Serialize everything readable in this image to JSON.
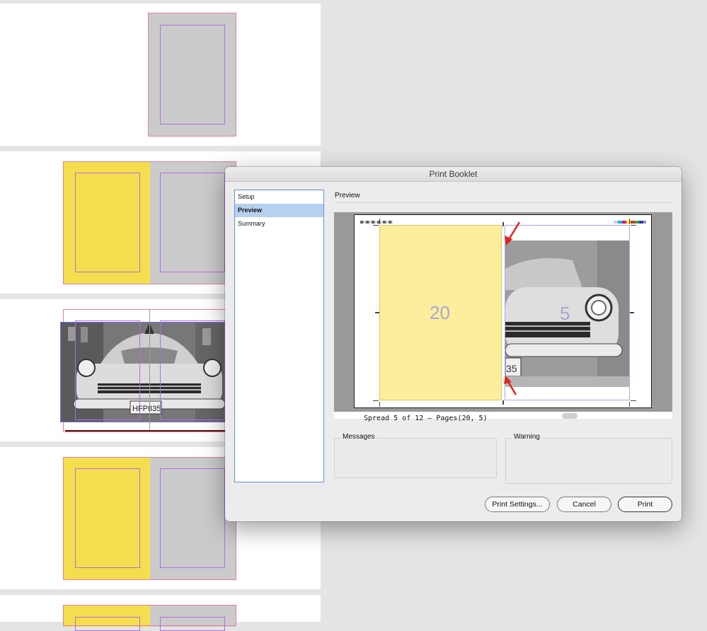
{
  "dialog": {
    "title": "Print Booklet",
    "sidebar": [
      {
        "label": "Setup",
        "active": false
      },
      {
        "label": "Preview",
        "active": true
      },
      {
        "label": "Summary",
        "active": false
      }
    ],
    "section_heading": "Preview",
    "preview": {
      "left_page_number": "20",
      "right_page_number": "5",
      "spread_caption": "Spread 5 of 12 – Pages(20, 5)"
    },
    "messages_label": "Messages",
    "warning_label": "Warning",
    "buttons": {
      "print_settings": "Print Settings...",
      "cancel": "Cancel",
      "print": "Print"
    }
  },
  "colors": {
    "page_yellow": "#f5de4e",
    "page_gray": "#cbcbcb",
    "preview_yellow": "#fcee9c",
    "selection_blue": "#b7d0ef",
    "annotation_red": "#e3231d"
  }
}
